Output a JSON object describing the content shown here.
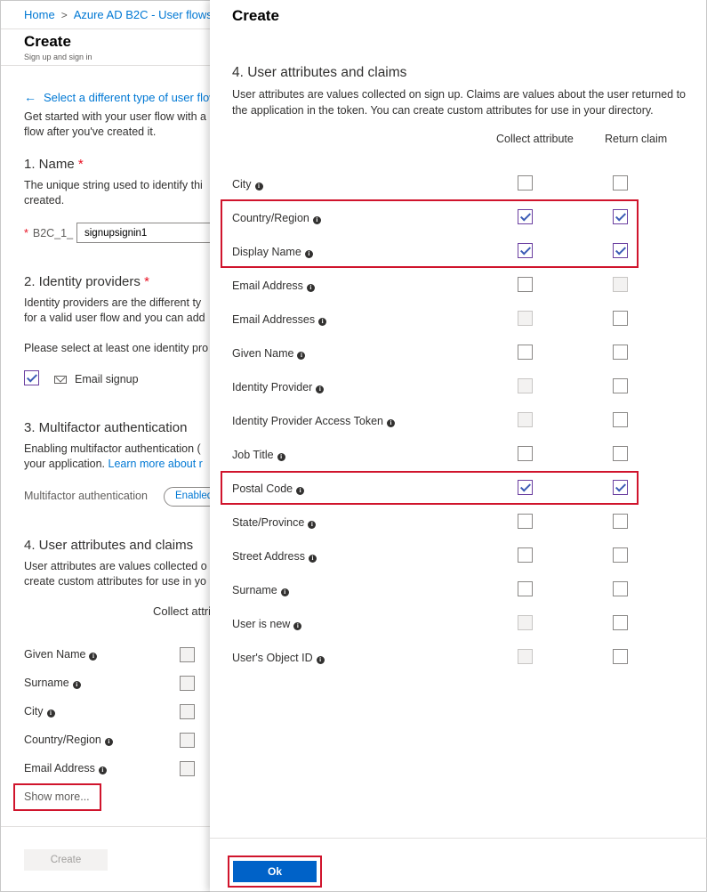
{
  "breadcrumb": {
    "home": "Home",
    "parent": "Azure AD B2C - User flows"
  },
  "left": {
    "title": "Create",
    "subtitle": "Sign up and sign in",
    "back_link": "Select a different type of user flow",
    "intro_line1": "Get started with your user flow with a",
    "intro_line2": "flow after you've created it.",
    "name_heading": "1. Name",
    "name_desc1": "The unique string used to identify thi",
    "name_desc2": "created.",
    "name_prefix": "B2C_1_",
    "name_value": "signupsignin1",
    "idp_heading": "2. Identity providers",
    "idp_desc1": "Identity providers are the different ty",
    "idp_desc2": "for a valid user flow and you can add",
    "idp_select": "Please select at least one identity pro",
    "email_signup": "Email signup",
    "mfa_heading": "3. Multifactor authentication",
    "mfa_desc1": "Enabling multifactor authentication (",
    "mfa_desc2": "your application.",
    "mfa_link": "Learn more about r",
    "mfa_label": "Multifactor authentication",
    "mfa_toggle": "Enabled",
    "attr_heading": "4. User attributes and claims",
    "attr_desc1": "User attributes are values collected o",
    "attr_desc2": "create custom attributes for use in yo",
    "collect_col": "Collect attri",
    "attributes": [
      "Given Name",
      "Surname",
      "City",
      "Country/Region",
      "Email Address"
    ],
    "show_more": "Show more...",
    "create_button": "Create"
  },
  "panel": {
    "title": "Create",
    "section": "4. User attributes and claims",
    "description": "User attributes are values collected on sign up. Claims are values about the user returned to the application in the token. You can create custom attributes for use in your directory.",
    "col_collect": "Collect attribute",
    "col_return": "Return claim",
    "rows": [
      {
        "label": "City",
        "collect": "unchecked",
        "return": "unchecked"
      },
      {
        "label": "Country/Region",
        "collect": "checked",
        "return": "checked"
      },
      {
        "label": "Display Name",
        "collect": "checked",
        "return": "checked"
      },
      {
        "label": "Email Address",
        "collect": "unchecked",
        "return": "disabled"
      },
      {
        "label": "Email Addresses",
        "collect": "disabled",
        "return": "unchecked"
      },
      {
        "label": "Given Name",
        "collect": "unchecked",
        "return": "unchecked"
      },
      {
        "label": "Identity Provider",
        "collect": "disabled",
        "return": "unchecked"
      },
      {
        "label": "Identity Provider Access Token",
        "collect": "disabled",
        "return": "unchecked"
      },
      {
        "label": "Job Title",
        "collect": "unchecked",
        "return": "unchecked"
      },
      {
        "label": "Postal Code",
        "collect": "checked",
        "return": "checked"
      },
      {
        "label": "State/Province",
        "collect": "unchecked",
        "return": "unchecked"
      },
      {
        "label": "Street Address",
        "collect": "unchecked",
        "return": "unchecked"
      },
      {
        "label": "Surname",
        "collect": "unchecked",
        "return": "unchecked"
      },
      {
        "label": "User is new",
        "collect": "disabled",
        "return": "unchecked"
      },
      {
        "label": "User's Object ID",
        "collect": "disabled",
        "return": "unchecked"
      }
    ],
    "ok_button": "Ok"
  },
  "colors": {
    "accent": "#0078d4",
    "highlight": "#d0142c",
    "ok_button": "#0062c8"
  }
}
